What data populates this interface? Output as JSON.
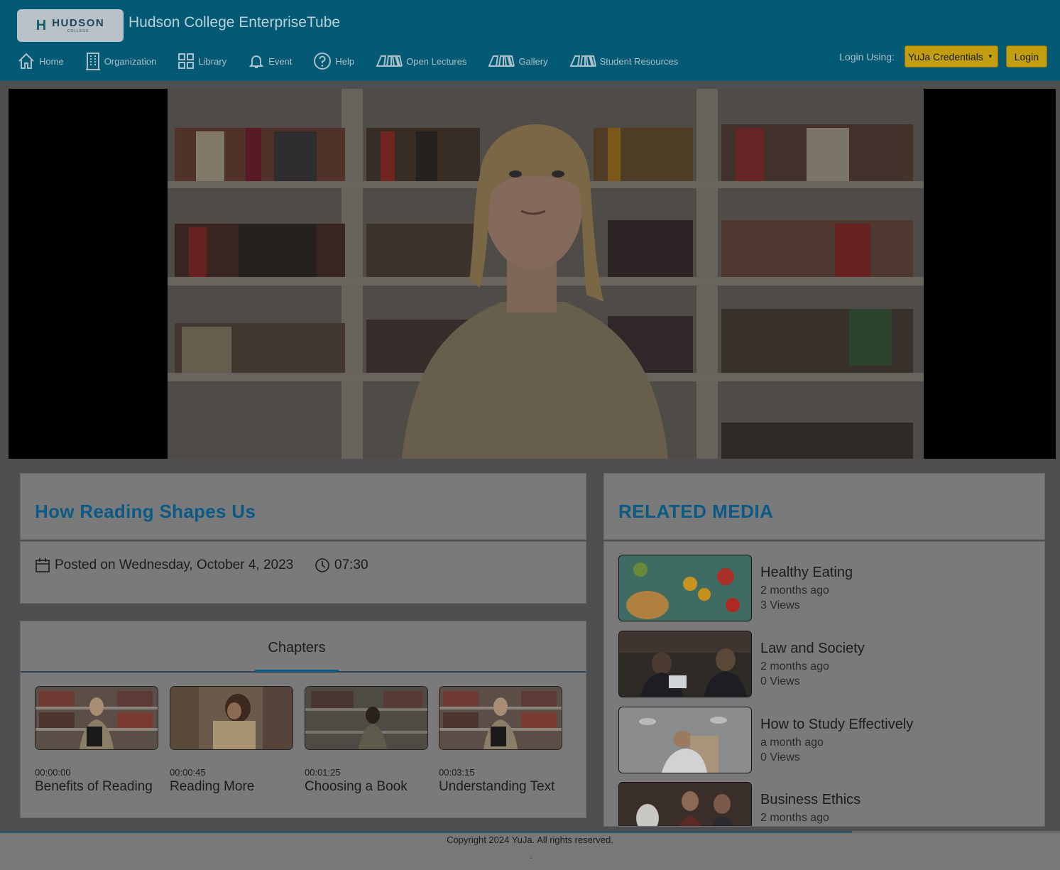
{
  "header": {
    "logo_text": "HUDSON",
    "logo_subtext": "COLLEGE",
    "site_title": "Hudson College EnterpriseTube",
    "nav": [
      {
        "label": "Home",
        "icon": "home-icon"
      },
      {
        "label": "Organization",
        "icon": "building-icon"
      },
      {
        "label": "Library",
        "icon": "grid-icon"
      },
      {
        "label": "Event",
        "icon": "bell-icon"
      },
      {
        "label": "Help",
        "icon": "help-circle-icon"
      },
      {
        "label": "Open Lectures",
        "icon": "books-icon"
      },
      {
        "label": "Gallery",
        "icon": "books-icon"
      },
      {
        "label": "Student Resources",
        "icon": "books-icon"
      }
    ],
    "login_label": "Login Using:",
    "credentials_selected": "YuJa Credentials",
    "login_button": "Login"
  },
  "video": {
    "title": "How Reading Shapes Us",
    "posted": "Posted on Wednesday, October 4, 2023",
    "duration": "07:30"
  },
  "chapters": {
    "tab_label": "Chapters",
    "items": [
      {
        "time": "00:00:00",
        "name": "Benefits of Reading"
      },
      {
        "time": "00:00:45",
        "name": "Reading More"
      },
      {
        "time": "00:01:25",
        "name": "Choosing a Book"
      },
      {
        "time": "00:03:15",
        "name": "Understanding Text"
      }
    ]
  },
  "related": {
    "heading": "RELATED MEDIA",
    "items": [
      {
        "title": "Healthy Eating",
        "ago": "2 months ago",
        "views": "3 Views"
      },
      {
        "title": "Law and Society",
        "ago": "2 months ago",
        "views": "0 Views"
      },
      {
        "title": "How to Study Effectively",
        "ago": "a month ago",
        "views": "0 Views"
      },
      {
        "title": "Business Ethics",
        "ago": "2 months ago",
        "views": ""
      }
    ]
  },
  "footer": {
    "copyright": "Copyright 2024 YuJa. All rights reserved.",
    "dash": "-"
  },
  "colors": {
    "header_bg": "#045a74",
    "accent_gold": "#c29e10",
    "title_blue": "#0a5a85"
  }
}
